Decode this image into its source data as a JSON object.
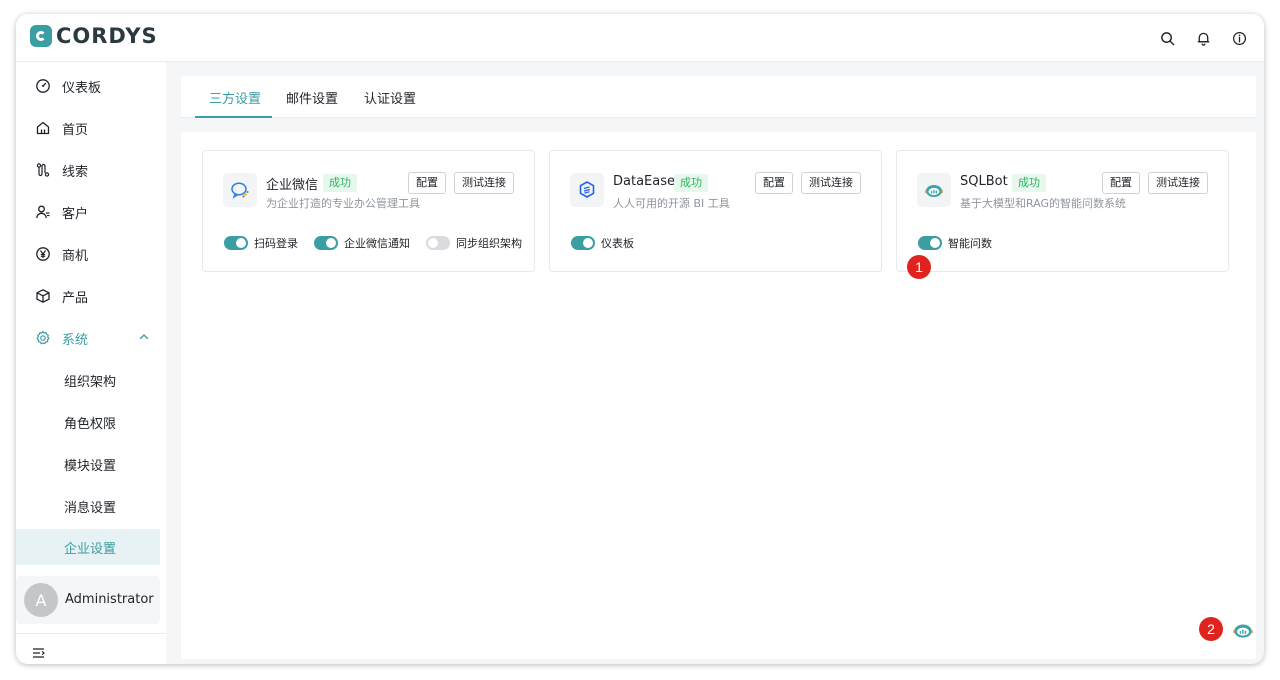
{
  "app": {
    "logo_text": "CORDYS",
    "brand_color": "#3a9ea2"
  },
  "topbar": {
    "icons": [
      "search-icon",
      "bell-icon",
      "info-icon"
    ]
  },
  "sidebar": {
    "items": [
      {
        "label": "仪表板",
        "icon": "dashboard-icon"
      },
      {
        "label": "首页",
        "icon": "home-icon"
      },
      {
        "label": "线索",
        "icon": "clue-icon"
      },
      {
        "label": "客户",
        "icon": "customer-icon"
      },
      {
        "label": "商机",
        "icon": "yen-icon"
      },
      {
        "label": "产品",
        "icon": "box-icon"
      },
      {
        "label": "系统",
        "icon": "gear-icon",
        "expanded": true
      }
    ],
    "sub_items": [
      {
        "label": "组织架构"
      },
      {
        "label": "角色权限"
      },
      {
        "label": "模块设置"
      },
      {
        "label": "消息设置"
      },
      {
        "label": "企业设置",
        "selected": true
      }
    ],
    "user": {
      "avatar_letter": "A",
      "name": "Administrator"
    }
  },
  "tabs": [
    {
      "label": "三方设置",
      "active": true
    },
    {
      "label": "邮件设置"
    },
    {
      "label": "认证设置"
    }
  ],
  "cards": [
    {
      "title": "企业微信",
      "status": "成功",
      "desc": "为企业打造的专业办公管理工具",
      "configure_label": "配置",
      "test_label": "测试连接",
      "toggles": [
        {
          "label": "扫码登录",
          "on": true
        },
        {
          "label": "企业微信通知",
          "on": true
        },
        {
          "label": "同步组织架构",
          "on": false
        }
      ]
    },
    {
      "title": "DataEase",
      "status": "成功",
      "desc": "人人可用的开源 BI 工具",
      "configure_label": "配置",
      "test_label": "测试连接",
      "toggles": [
        {
          "label": "仪表板",
          "on": true
        }
      ]
    },
    {
      "title": "SQLBot",
      "status": "成功",
      "desc": "基于大模型和RAG的智能问数系统",
      "configure_label": "配置",
      "test_label": "测试连接",
      "toggles": [
        {
          "label": "智能问数",
          "on": true
        }
      ]
    }
  ],
  "markers": [
    "1",
    "2"
  ]
}
